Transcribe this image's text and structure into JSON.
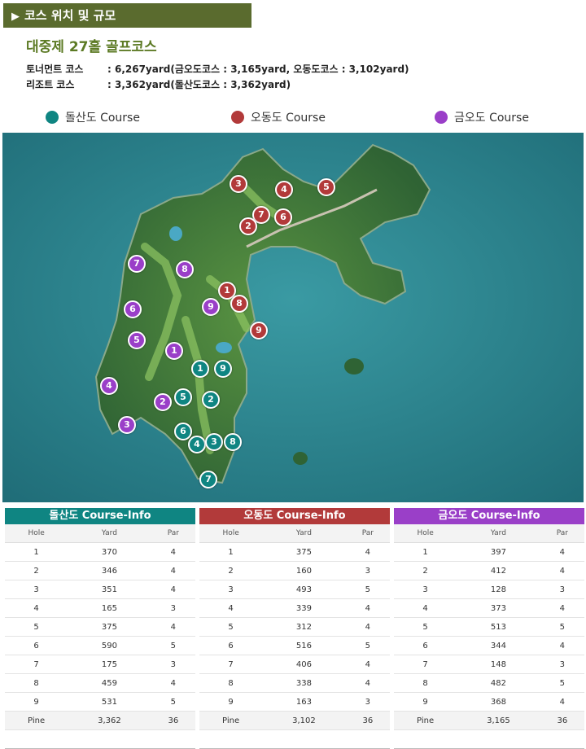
{
  "header": {
    "title": "코스 위치 및 규모"
  },
  "course_title": "대중제 27홀 골프코스",
  "info": [
    {
      "label": "토너먼트 코스",
      "value": ": 6,267yard(금오도코스 : 3,165yard, 오동도코스 : 3,102yard)"
    },
    {
      "label": "리조트 코스",
      "value": ": 3,362yard(돌산도코스 : 3,362yard)"
    }
  ],
  "legend": [
    {
      "name": "돌산도  Course",
      "color": "#0f8582"
    },
    {
      "name": "오동도  Course",
      "color": "#b23a3a"
    },
    {
      "name": "금오도   Course",
      "color": "#9a3fc8"
    }
  ],
  "colors": {
    "dolsan": "#0f8582",
    "odong": "#b23a3a",
    "geumo": "#9a3fc8",
    "sea": "#2f8c96",
    "land": "#3f7a3c"
  },
  "map_markers": {
    "dolsan": [
      "1",
      "2",
      "3",
      "4",
      "5",
      "6",
      "7",
      "8",
      "9"
    ],
    "odong": [
      "1",
      "2",
      "3",
      "4",
      "5",
      "6",
      "7",
      "8",
      "9"
    ],
    "geumo": [
      "1",
      "2",
      "3",
      "4",
      "5",
      "6",
      "7",
      "8",
      "9"
    ]
  },
  "tables": [
    {
      "title": "돌산도 Course-Info",
      "color": "#0f8582",
      "columns": [
        "Hole",
        "Yard",
        "Par"
      ],
      "rows": [
        [
          "1",
          "370",
          "4"
        ],
        [
          "2",
          "346",
          "4"
        ],
        [
          "3",
          "351",
          "4"
        ],
        [
          "4",
          "165",
          "3"
        ],
        [
          "5",
          "375",
          "4"
        ],
        [
          "6",
          "590",
          "5"
        ],
        [
          "7",
          "175",
          "3"
        ],
        [
          "8",
          "459",
          "4"
        ],
        [
          "9",
          "531",
          "5"
        ]
      ],
      "total": [
        "Pine",
        "3,362",
        "36"
      ]
    },
    {
      "title": "오동도 Course-Info",
      "color": "#b23a3a",
      "columns": [
        "Hole",
        "Yard",
        "Par"
      ],
      "rows": [
        [
          "1",
          "375",
          "4"
        ],
        [
          "2",
          "160",
          "3"
        ],
        [
          "3",
          "493",
          "5"
        ],
        [
          "4",
          "339",
          "4"
        ],
        [
          "5",
          "312",
          "4"
        ],
        [
          "6",
          "516",
          "5"
        ],
        [
          "7",
          "406",
          "4"
        ],
        [
          "8",
          "338",
          "4"
        ],
        [
          "9",
          "163",
          "3"
        ]
      ],
      "total": [
        "Pine",
        "3,102",
        "36"
      ]
    },
    {
      "title": "금오도 Course-Info",
      "color": "#9a3fc8",
      "columns": [
        "Hole",
        "Yard",
        "Par"
      ],
      "rows": [
        [
          "1",
          "397",
          "4"
        ],
        [
          "2",
          "412",
          "4"
        ],
        [
          "3",
          "128",
          "3"
        ],
        [
          "4",
          "373",
          "4"
        ],
        [
          "5",
          "513",
          "5"
        ],
        [
          "6",
          "344",
          "4"
        ],
        [
          "7",
          "148",
          "3"
        ],
        [
          "8",
          "482",
          "5"
        ],
        [
          "9",
          "368",
          "4"
        ]
      ],
      "total": [
        "Pine",
        "3,165",
        "36"
      ]
    }
  ]
}
